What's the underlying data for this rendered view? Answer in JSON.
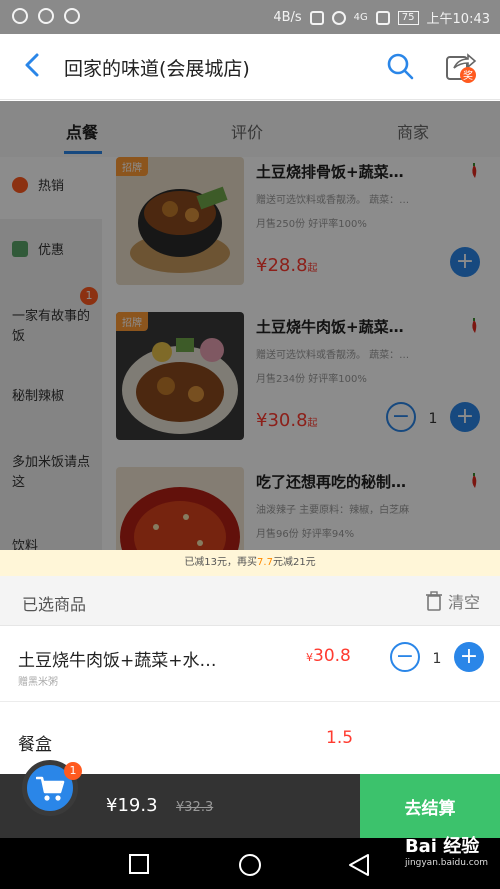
{
  "status_bar": {
    "network": "4B/s",
    "battery": "75",
    "time": "上午10:43",
    "signal": "4G"
  },
  "header": {
    "title": "回家的味道(会展城店)",
    "share_badge": "奖"
  },
  "tabs": [
    "点餐",
    "评价",
    "商家"
  ],
  "sidebar": {
    "items": [
      {
        "label": "热销",
        "icon_color": "#ff5a1f"
      },
      {
        "label": "优惠",
        "icon_color": "#5aa469"
      },
      {
        "label": "一家有故事的饭",
        "badge": "1"
      },
      {
        "label": "秘制辣椒"
      },
      {
        "label": "多加米饭请点这"
      },
      {
        "label": "饮料"
      }
    ]
  },
  "items": [
    {
      "tag": "招牌",
      "name": "土豆烧排骨饭+蔬菜…",
      "desc": "赠送可选饮料或香靓汤。 蔬菜：…",
      "sales": "月售250份  好评率100%",
      "price": "¥28.8",
      "price_suffix": "起"
    },
    {
      "tag": "招牌",
      "name": "土豆烧牛肉饭+蔬菜…",
      "desc": "赠送可选饮料或香靓汤。 蔬菜：…",
      "sales": "月售234份  好评率100%",
      "price": "¥30.8",
      "price_suffix": "起",
      "qty": "1"
    },
    {
      "name": "吃了还想再吃的秘制…",
      "desc": "油泼辣子  主要原料：辣椒，白芝麻",
      "sales": "月售96份  好评率94%"
    }
  ],
  "promo": {
    "pre": "已减13元，再买",
    "amount": "7.7",
    "post": "元减21元"
  },
  "cart": {
    "title": "已选商品",
    "clear_label": "清空",
    "rows": [
      {
        "name": "土豆烧牛肉饭+蔬菜+水…",
        "sub": "赠黑米粥",
        "price_symbol": "¥",
        "price": "30.8",
        "qty": "1"
      },
      {
        "name": "餐盒",
        "price": "1.5"
      }
    ]
  },
  "bottom": {
    "cart_badge": "1",
    "total": "¥19.3",
    "original": "¥32.3",
    "checkout_label": "去结算"
  },
  "watermark": {
    "brand": "Bai 经验",
    "url": "jingyan.baidu.com"
  },
  "colors": {
    "accent": "#2a86e8",
    "price": "#ff3b30",
    "checkout": "#3cc26c",
    "badge": "#ff5a1f"
  }
}
